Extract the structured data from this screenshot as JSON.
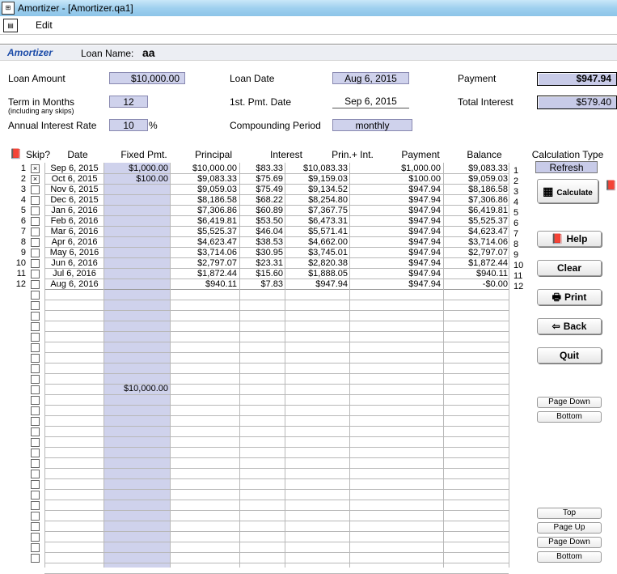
{
  "window": {
    "title": "Amortizer - [Amortizer.qa1]"
  },
  "menu": {
    "edit": "Edit"
  },
  "header": {
    "app_name": "Amortizer",
    "loan_name_label": "Loan Name:",
    "loan_name_value": "aa"
  },
  "form": {
    "loan_amount_label": "Loan Amount",
    "loan_amount": "$10,000.00",
    "term_label": "Term in Months",
    "term_sub": "(including any skips)",
    "term": "12",
    "rate_label": "Annual Interest Rate",
    "rate": "10",
    "rate_unit": "%",
    "loan_date_label": "Loan Date",
    "loan_date": "Aug 6, 2015",
    "first_pmt_label": "1st. Pmt. Date",
    "first_pmt": "Sep 6, 2015",
    "compounding_label": "Compounding Period",
    "compounding": "monthly",
    "payment_label": "Payment",
    "payment": "$947.94",
    "total_interest_label": "Total Interest",
    "total_interest": "$579.40"
  },
  "table": {
    "headers": {
      "skip": "Skip?",
      "date": "Date",
      "fixed": "Fixed Pmt.",
      "principal": "Principal",
      "interest": "Interest",
      "prin_int": "Prin.+ Int.",
      "payment": "Payment",
      "balance": "Balance"
    },
    "rows": [
      {
        "n": "1",
        "skip": true,
        "date": "Sep 6, 2015",
        "fixed": "$1,000.00",
        "principal": "$10,000.00",
        "interest": "$83.33",
        "prin_int": "$10,083.33",
        "payment": "$1,000.00",
        "balance": "$9,083.33"
      },
      {
        "n": "2",
        "skip": true,
        "date": "Oct 6, 2015",
        "fixed": "$100.00",
        "principal": "$9,083.33",
        "interest": "$75.69",
        "prin_int": "$9,159.03",
        "payment": "$100.00",
        "balance": "$9,059.03"
      },
      {
        "n": "3",
        "skip": false,
        "date": "Nov 6, 2015",
        "fixed": "",
        "principal": "$9,059.03",
        "interest": "$75.49",
        "prin_int": "$9,134.52",
        "payment": "$947.94",
        "balance": "$8,186.58"
      },
      {
        "n": "4",
        "skip": false,
        "date": "Dec 6, 2015",
        "fixed": "",
        "principal": "$8,186.58",
        "interest": "$68.22",
        "prin_int": "$8,254.80",
        "payment": "$947.94",
        "balance": "$7,306.86"
      },
      {
        "n": "5",
        "skip": false,
        "date": "Jan 6, 2016",
        "fixed": "",
        "principal": "$7,306.86",
        "interest": "$60.89",
        "prin_int": "$7,367.75",
        "payment": "$947.94",
        "balance": "$6,419.81"
      },
      {
        "n": "6",
        "skip": false,
        "date": "Feb 6, 2016",
        "fixed": "",
        "principal": "$6,419.81",
        "interest": "$53.50",
        "prin_int": "$6,473.31",
        "payment": "$947.94",
        "balance": "$5,525.37"
      },
      {
        "n": "7",
        "skip": false,
        "date": "Mar 6, 2016",
        "fixed": "",
        "principal": "$5,525.37",
        "interest": "$46.04",
        "prin_int": "$5,571.41",
        "payment": "$947.94",
        "balance": "$4,623.47"
      },
      {
        "n": "8",
        "skip": false,
        "date": "Apr 6, 2016",
        "fixed": "",
        "principal": "$4,623.47",
        "interest": "$38.53",
        "prin_int": "$4,662.00",
        "payment": "$947.94",
        "balance": "$3,714.06"
      },
      {
        "n": "9",
        "skip": false,
        "date": "May 6, 2016",
        "fixed": "",
        "principal": "$3,714.06",
        "interest": "$30.95",
        "prin_int": "$3,745.01",
        "payment": "$947.94",
        "balance": "$2,797.07"
      },
      {
        "n": "10",
        "skip": false,
        "date": "Jun 6, 2016",
        "fixed": "",
        "principal": "$2,797.07",
        "interest": "$23.31",
        "prin_int": "$2,820.38",
        "payment": "$947.94",
        "balance": "$1,872.44"
      },
      {
        "n": "11",
        "skip": false,
        "date": "Jul 6, 2016",
        "fixed": "",
        "principal": "$1,872.44",
        "interest": "$15.60",
        "prin_int": "$1,888.05",
        "payment": "$947.94",
        "balance": "$940.11"
      },
      {
        "n": "12",
        "skip": false,
        "date": "Aug 6, 2016",
        "fixed": "",
        "principal": "$940.11",
        "interest": "$7.83",
        "prin_int": "$947.94",
        "payment": "$947.94",
        "balance": "-$0.00"
      }
    ],
    "fixed_total": "$10,000.00"
  },
  "side": {
    "calc_type_label": "Calculation Type",
    "calc_type": "Refresh",
    "calculate": "Calculate",
    "help": "Help",
    "clear": "Clear",
    "print": "Print",
    "back": "Back",
    "quit": "Quit",
    "page_down": "Page Down",
    "bottom": "Bottom",
    "top": "Top",
    "page_up": "Page Up"
  }
}
